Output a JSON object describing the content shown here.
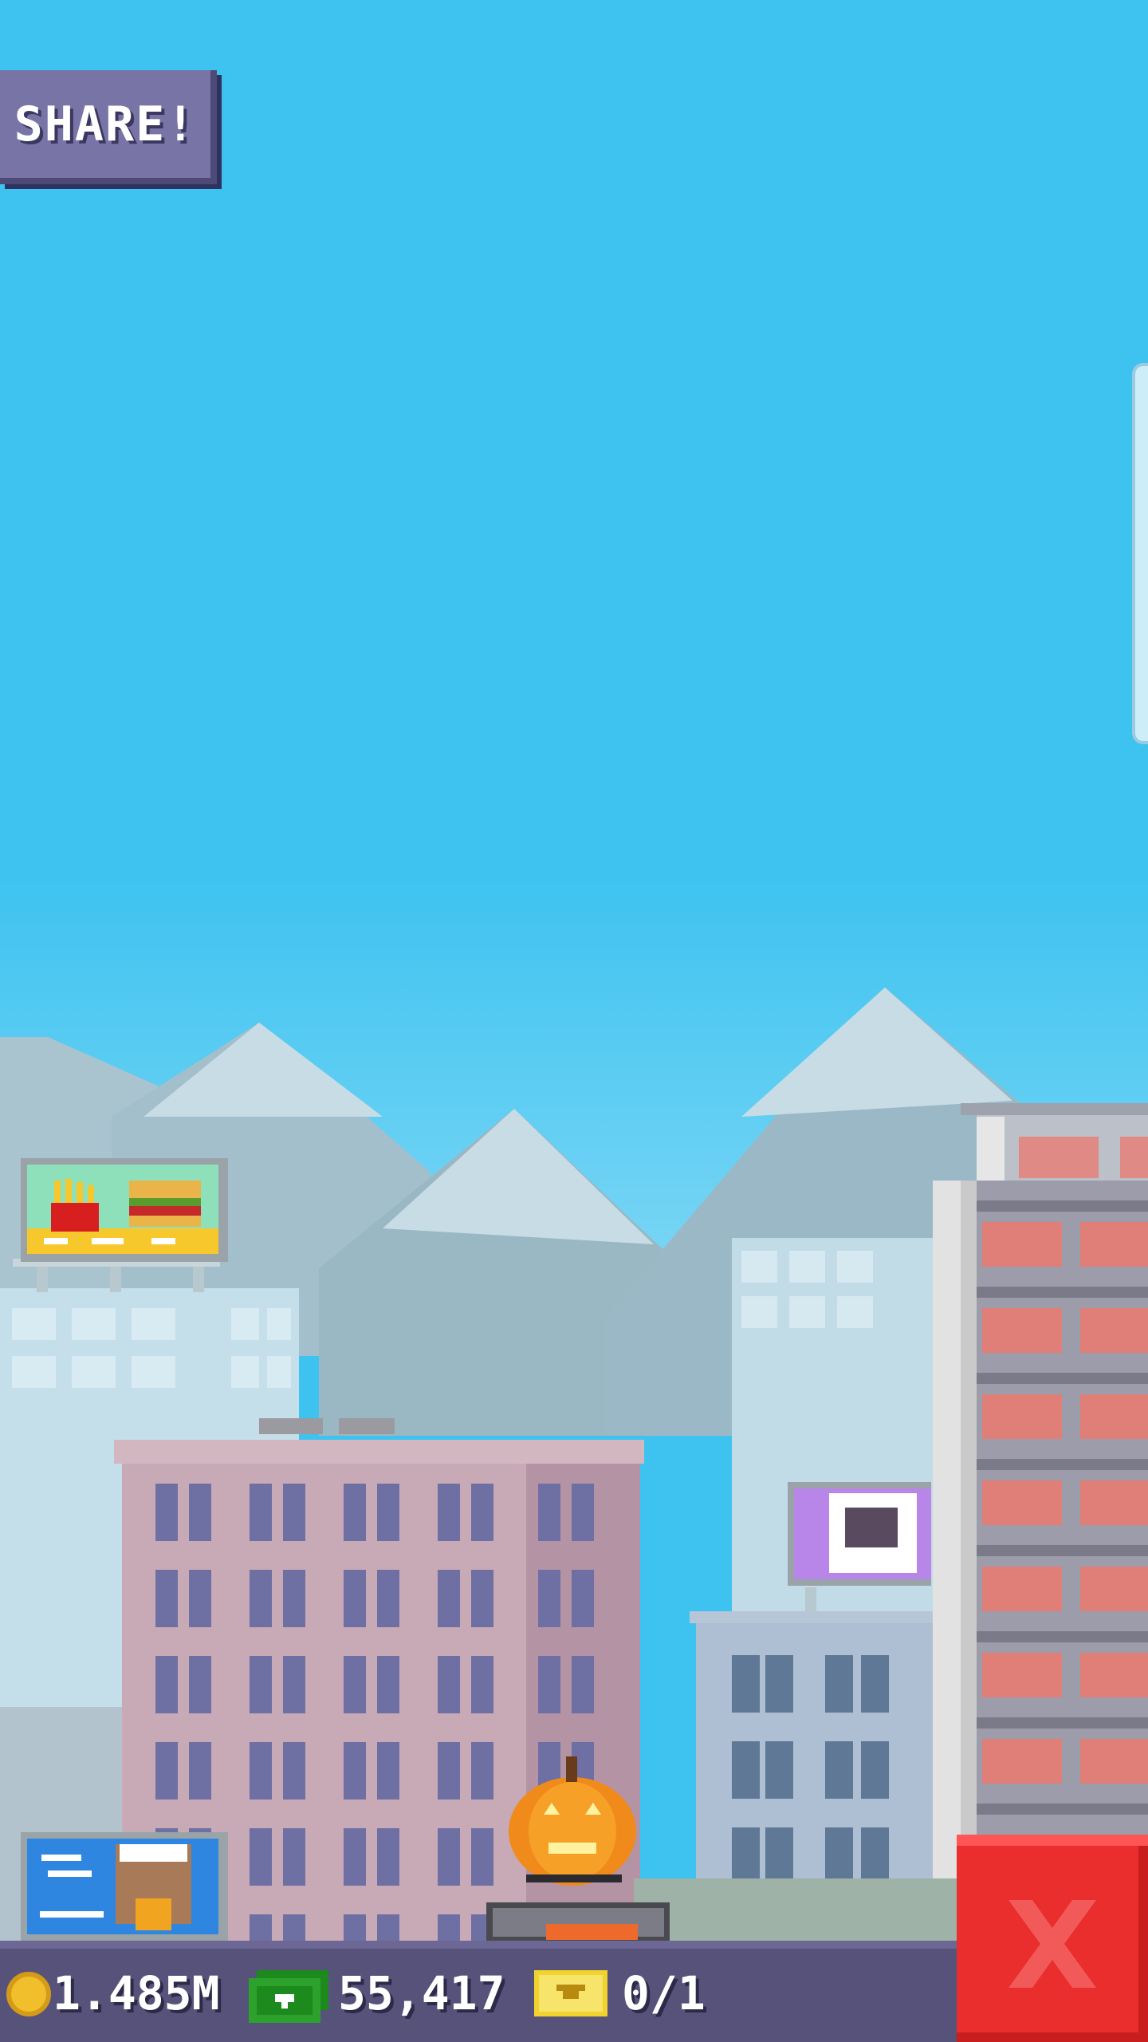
{
  "share_button": {
    "label": "SHARE!"
  },
  "hud": {
    "coins": "1.485M",
    "cash": "55,417",
    "tickets": "0/1"
  },
  "icons": {
    "coin": "coin-icon",
    "cash": "cash-icon",
    "ticket": "ticket-icon",
    "close": "close-icon"
  },
  "colors": {
    "sky": "#3ec3f0",
    "hud_bar": "#57527a",
    "close_button": "#ea2d2d",
    "share_button": "#7874a6",
    "coin": "#f2bf2c",
    "cash": "#2ca12c",
    "ticket": "#f2d22c"
  }
}
